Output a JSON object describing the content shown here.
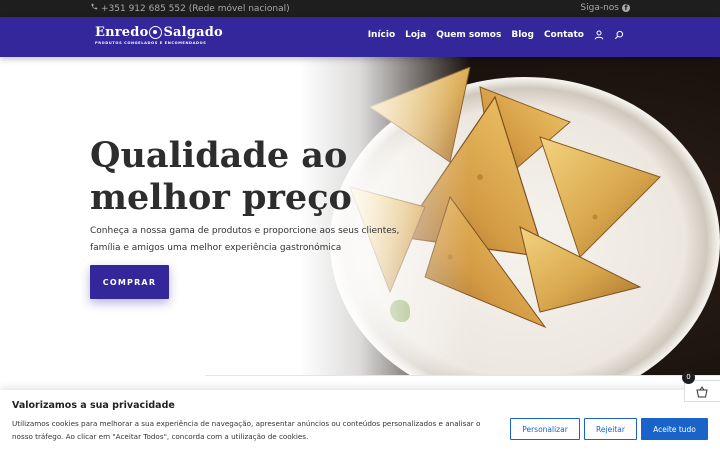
{
  "topbar": {
    "phone": "+351 912 685 552 (Rede móvel nacional)",
    "follow_label": "Siga-nos"
  },
  "header": {
    "logo_left": "Enredo",
    "logo_right": "Salgado",
    "logo_tagline": "PRODUTOS CONGELADOS E ENCOMENDADOS",
    "nav": [
      "Início",
      "Loja",
      "Quem somos",
      "Blog",
      "Contato"
    ]
  },
  "hero": {
    "title_line1": "Qualidade ao",
    "title_line2": "melhor preço",
    "subtitle": "Conheça a nossa gama de produtos e proporcione aos seus clientes, família e amigos uma melhor experiência gastronómica",
    "cta": "COMPRAR"
  },
  "cart": {
    "count": "0"
  },
  "cookie": {
    "title": "Valorizamos a sua privacidade",
    "text": "Utilizamos cookies para melhorar a sua experiência de navegação, apresentar anúncios ou conteúdos personalizados e analisar o nosso tráfego. Ao clicar em \"Aceitar Todos\", concorda com a utilização de cookies.",
    "customize": "Personalizar",
    "reject": "Rejeitar",
    "accept": "Aceite tudo"
  },
  "colors": {
    "brand": "#33279b",
    "topbar": "#1e1e1e",
    "cookie_accent": "#1a63c9"
  },
  "icons": [
    "phone-icon",
    "facebook-icon",
    "user-icon",
    "search-icon",
    "cart-icon"
  ]
}
